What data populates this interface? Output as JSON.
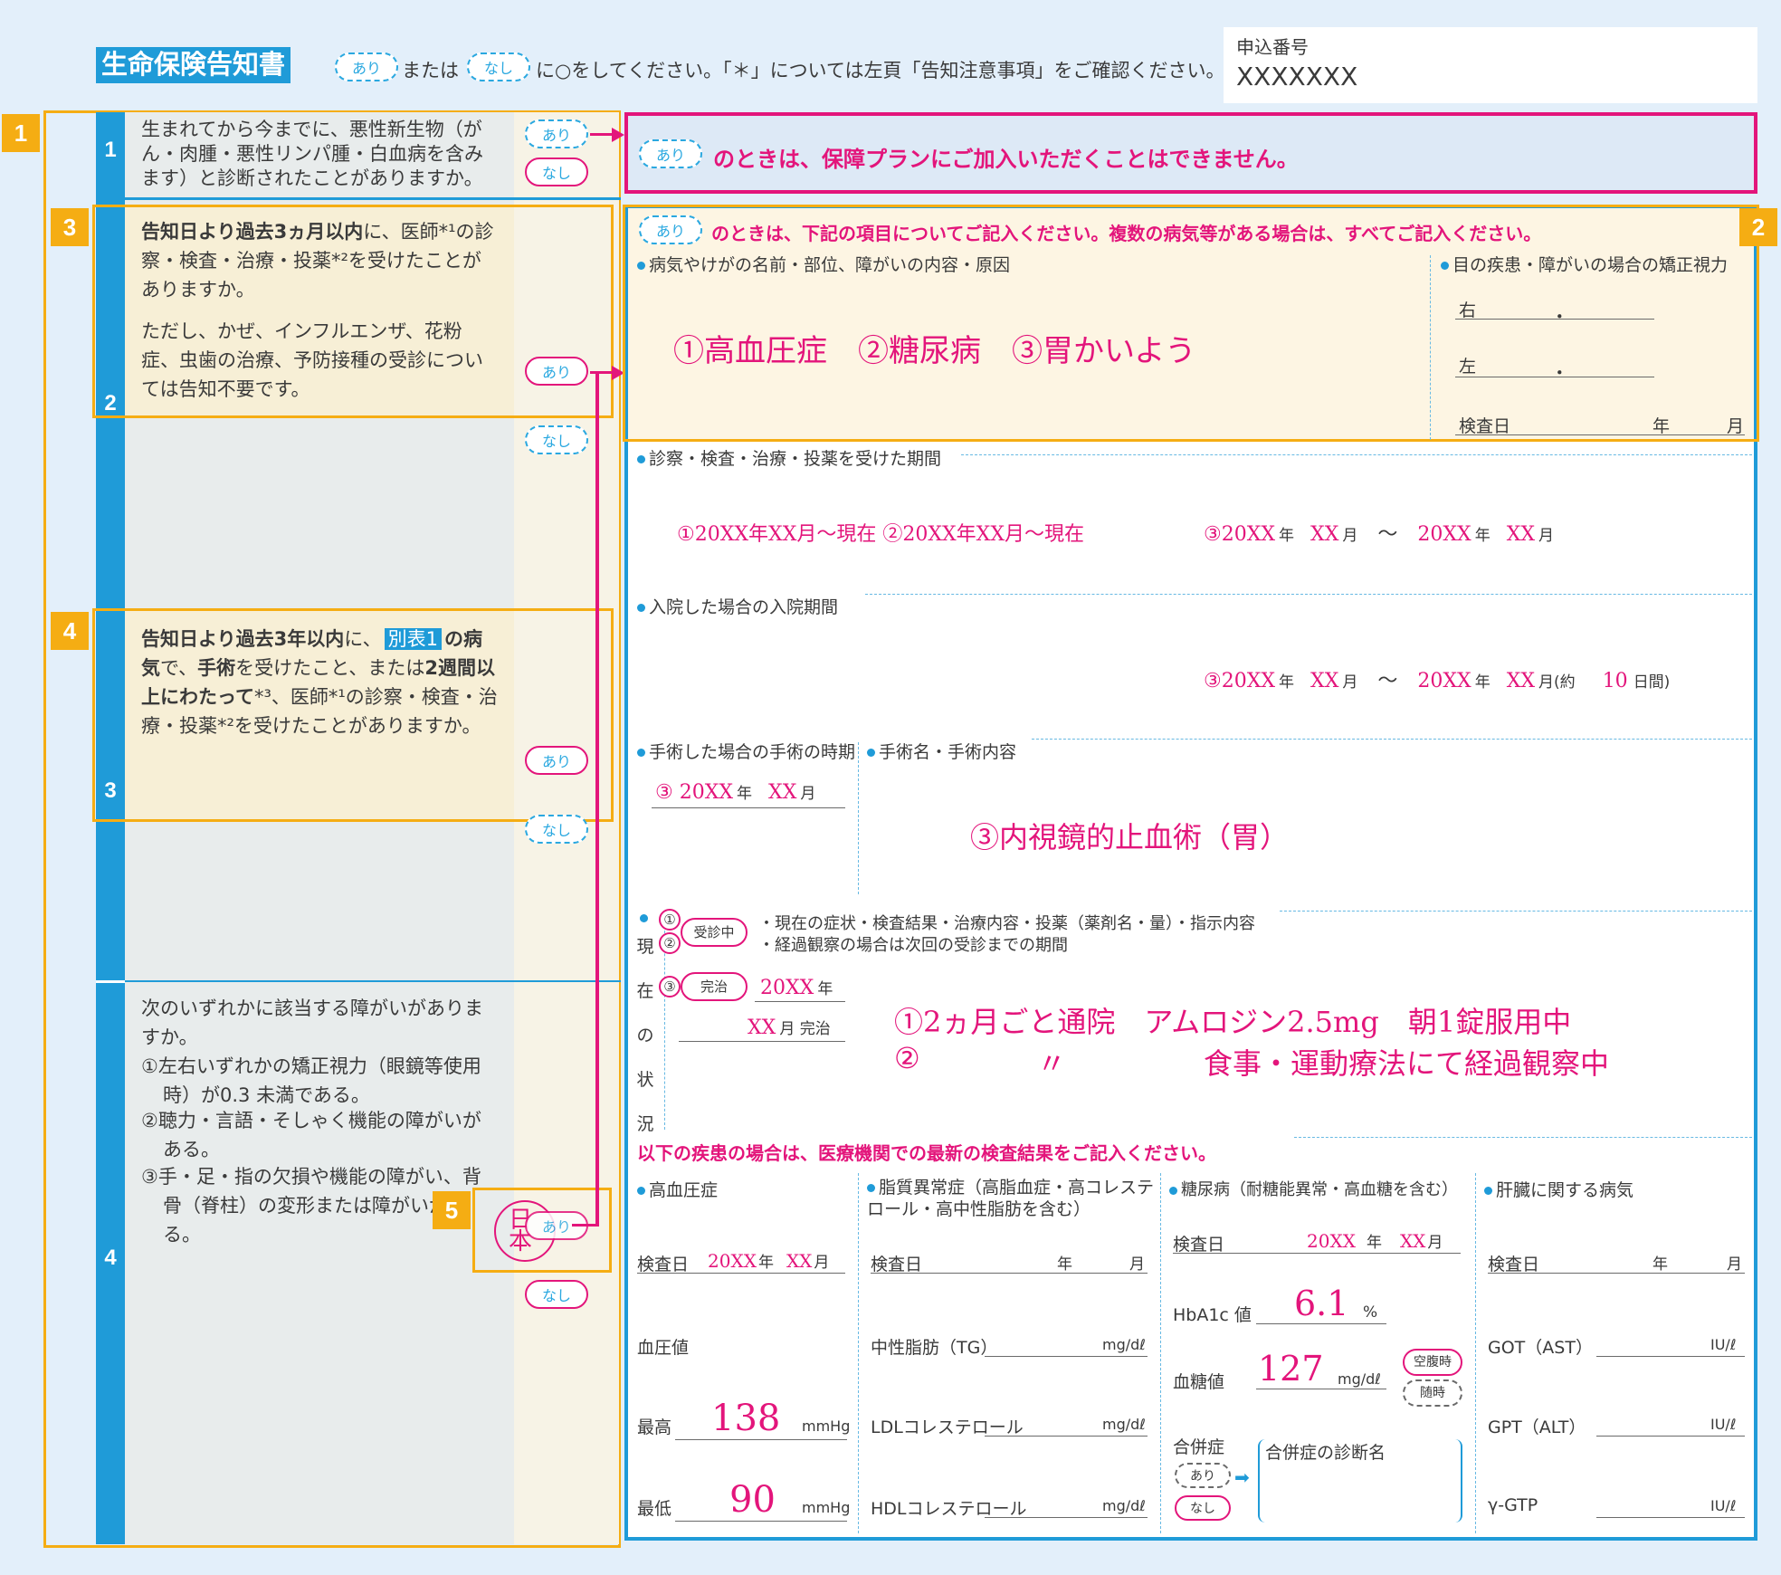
{
  "header": {
    "title": "生命保険告知書",
    "ari": "あり",
    "mata": "または",
    "nashi": "なし",
    "instruction": "に○をしてください。「＊」については左頁「告知注意事項」をご確認ください。",
    "app_no_label": "申込番号",
    "app_no": "XXXXXXX"
  },
  "badges": {
    "b1": "1",
    "b2": "2",
    "b3": "3",
    "b4": "4",
    "b5": "5"
  },
  "questions": {
    "q1": {
      "num": "1",
      "text": "生まれてから今までに、悪性新生物（がん・肉腫・悪性リンパ腫・白血病を含みます）と診断されたことがありますか。"
    },
    "q2": {
      "num": "2",
      "lead": "告知日より過去3ヵ月以内",
      "text1": "に、医師*¹の診察・検査・治療・投薬*²を受けたことがありますか。",
      "text2": "ただし、かぜ、インフルエンザ、花粉症、虫歯の治療、予防接種の受診については告知不要です。"
    },
    "q3": {
      "num": "3",
      "lead": "告知日より過去3年以内",
      "text1": "に、",
      "table_tag": "別表1",
      "text2": "の病気",
      "text3": "で、",
      "bold3": "手術",
      "text4": "を受けたこと、または",
      "bold4": "2週間以上にわたって",
      "text5": "*³、医師*¹の診察・検査・治療・投薬*²を受けたことがありますか。"
    },
    "q4": {
      "num": "4",
      "lines": [
        "次のいずれかに該当する障がいがありますか。",
        "①左右いずれかの矯正視力（眼鏡等使用時）が0.3 未満である。",
        "②聴力・言語・そしゃく機能の障がいがある。",
        "③手・足・指の欠損や機能の障がい、背骨（脊柱）の変形または障がいがある。"
      ]
    }
  },
  "pills": {
    "ari": "あり",
    "nashi": "なし"
  },
  "r1": {
    "text": "のときは、保障プランにご加入いただくことはできません。"
  },
  "r2": {
    "text": "のときは、下記の項目についてご記入ください。複数の病気等がある場合は、すべてご記入ください。",
    "disease_label": "病気やけがの名前・部位、障がいの内容・原因",
    "disease_value": "①高血圧症　②糖尿病　③胃かいよう",
    "vision_label": "目の疾患・障がいの場合の矯正視力",
    "right": "右",
    "left": "左",
    "period_dot": "．",
    "exam_date": "検査日",
    "year": "年",
    "month": "月"
  },
  "period": {
    "label": "診察・検査・治療・投薬を受けた期間",
    "v1": "①20XX年XX月～現在 ②20XX年XX月～現在",
    "v3a": "③20XX",
    "v3b": "XX",
    "v3c": "～",
    "v3d": "20XX",
    "v3e": "XX"
  },
  "hosp": {
    "label": "入院した場合の入院期間",
    "a": "③20XX",
    "b": "XX",
    "c": "～",
    "d": "20XX",
    "e": "XX",
    "f": "月(約",
    "g": "10",
    "h": "日間)"
  },
  "surgery": {
    "when_label": "手術した場合の手術の時期",
    "when_value": "③ 20XX",
    "when_month": "XX",
    "name_label": "手術名・手術内容",
    "name_value": "③内視鏡的止血術（胃）"
  },
  "current": {
    "vertical": [
      "現",
      "在",
      "の",
      "状",
      "況"
    ],
    "c1": "①",
    "c2": "②",
    "c3": "③",
    "jushin": "受診中",
    "kanchi": "完治",
    "note1": "・現在の症状・検査結果・治療内容・投薬（薬剤名・量）・指示内容",
    "note2": "・経過観察の場合は次回の受診までの期間",
    "kanchi_year": "20XX",
    "kanchi_month": "XX",
    "kanchi_suffix": "月 完治",
    "detail1": "①2ヵ月ごと通院　アムロジン2.5mg　朝1錠服用中",
    "detail2a": "②",
    "detail2b": "〃",
    "detail2c": "食事・運動療法にて経過観察中"
  },
  "tests": {
    "heading": "以下の疾患の場合は、医療機関での最新の検査結果をご記入ください。",
    "hbp": {
      "label": "高血圧症",
      "exam": "検査日",
      "year_v": "20XX",
      "month_v": "XX",
      "bp": "血圧値",
      "high": "最高",
      "high_v": "138",
      "low": "最低",
      "low_v": "90",
      "unit": "mmHg"
    },
    "lipid": {
      "label": "脂質異常症（高脂血症・高コレステロール・高中性脂肪を含む）",
      "exam": "検査日",
      "tg": "中性脂肪（TG）",
      "ldl": "LDLコレステロール",
      "hdl": "HDLコレステロール",
      "unit": "mg/dℓ"
    },
    "dm": {
      "label": "糖尿病（耐糖能異常・高血糖を含む）",
      "exam": "検査日",
      "year_v": "20XX",
      "month_v": "XX",
      "hba1c": "HbA1c 値",
      "hba1c_v": "6.1",
      "pct": "%",
      "glucose": "血糖値",
      "glucose_v": "127",
      "unit": "mg/dℓ",
      "fasting": "空腹時",
      "random": "随時",
      "comp": "合併症",
      "comp_name": "合併症の診断名"
    },
    "liver": {
      "label": "肝臓に関する病気",
      "exam": "検査日",
      "got": "GOT（AST）",
      "gpt": "GPT（ALT）",
      "ggt": "γ-GTP",
      "unit": "IU/ℓ"
    }
  },
  "stamp": "日本"
}
